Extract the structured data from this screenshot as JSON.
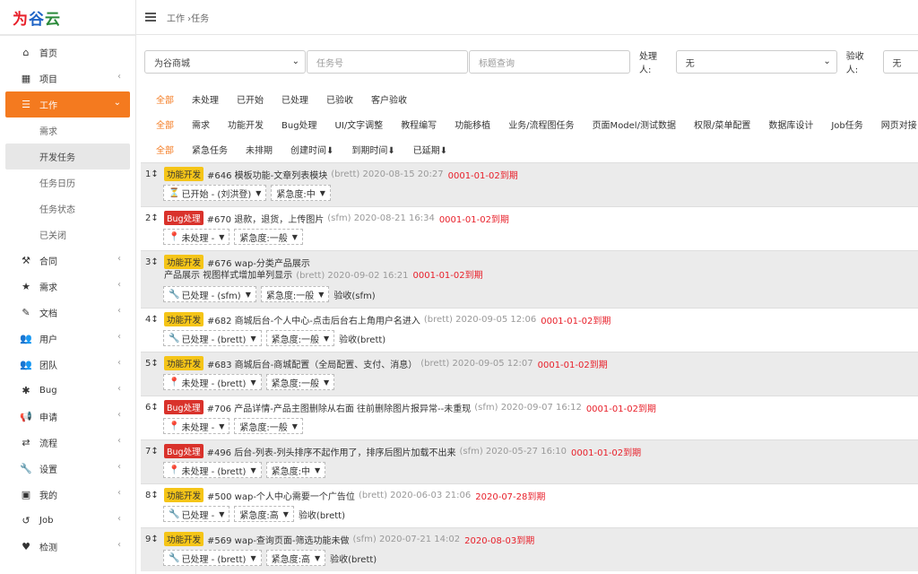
{
  "sidebar": {
    "logo": {
      "c1": "为",
      "c2": "谷",
      "c3": "云"
    },
    "items": [
      {
        "label": "首页",
        "icon": "home-icon",
        "glyph": "⌂"
      },
      {
        "label": "项目",
        "icon": "project-icon",
        "glyph": "▦"
      },
      {
        "label": "工作",
        "icon": "work-icon",
        "glyph": "☰"
      },
      {
        "label": "合同",
        "icon": "contract-icon",
        "glyph": "⚒"
      },
      {
        "label": "需求",
        "icon": "star-icon",
        "glyph": "★"
      },
      {
        "label": "文档",
        "icon": "document-icon",
        "glyph": "✎"
      },
      {
        "label": "用户",
        "icon": "users-icon",
        "glyph": "👥"
      },
      {
        "label": "团队",
        "icon": "team-icon",
        "glyph": "👥"
      },
      {
        "label": "Bug",
        "icon": "bug-icon",
        "glyph": "✱"
      },
      {
        "label": "申请",
        "icon": "megaphone-icon",
        "glyph": "📢"
      },
      {
        "label": "流程",
        "icon": "flow-icon",
        "glyph": "⇄"
      },
      {
        "label": "设置",
        "icon": "wrench-icon",
        "glyph": "🔧"
      },
      {
        "label": "我的",
        "icon": "briefcase-icon",
        "glyph": "▣"
      },
      {
        "label": "Job",
        "icon": "history-icon",
        "glyph": "↺"
      },
      {
        "label": "检测",
        "icon": "heartbeat-icon",
        "glyph": "♥"
      }
    ],
    "work_sub": [
      "需求",
      "开发任务",
      "任务日历",
      "任务状态",
      "已关闭"
    ]
  },
  "topbar": {
    "breadcrumb": "工作 ›任务"
  },
  "filters": {
    "project": "为谷商城",
    "task_no_ph": "任务号",
    "title_ph": "标题查询",
    "handler_label": "处理人:",
    "handler_value": "无",
    "acceptor_label": "验收人:",
    "acceptor_value": "无"
  },
  "tabs": {
    "status": [
      "全部",
      "未处理",
      "已开始",
      "已处理",
      "已验收",
      "客户验收"
    ],
    "type": [
      "全部",
      "需求",
      "功能开发",
      "Bug处理",
      "UI/文字调整",
      "教程编写",
      "功能移植",
      "业务/流程图任务",
      "页面Model/测试数据",
      "权限/菜单配置",
      "数据库设计",
      "Job任务",
      "网页对接"
    ],
    "time": [
      "全部",
      "紧急任务",
      "未排期",
      "创建时间⬇",
      "到期时间⬇",
      "已延期⬇"
    ]
  },
  "tasks": [
    {
      "num": "1↕",
      "badge": "功能开发",
      "title": "#646 模板功能-文章列表模块",
      "meta": "(brett) 2020-08-15 20:27",
      "due": "0001-01-02到期",
      "desc": "",
      "status_icon": "hourglass-icon",
      "status_glyph": "⏳",
      "status": "已开始 - (刘洪登)",
      "urgency": "紧急度:中",
      "accept": ""
    },
    {
      "num": "2↕",
      "badge": "Bug处理",
      "title": "#670 退款，退货，上传图片",
      "meta": "(sfm) 2020-08-21 16:34",
      "due": "0001-01-02到期",
      "desc": "",
      "status_icon": "pin-icon",
      "status_glyph": "📍",
      "status": "未处理 -",
      "urgency": "紧急度:一般",
      "accept": ""
    },
    {
      "num": "3↕",
      "badge": "功能开发",
      "title": "#676 wap-分类产品展示",
      "meta": "",
      "due": "",
      "desc_text": "产品展示 视图样式增加单列显示",
      "desc_meta": "(brett) 2020-09-02 16:21",
      "desc_due": "0001-01-02到期",
      "status_icon": "wrench-icon",
      "status_glyph": "🔧",
      "status": "已处理 - (sfm)",
      "urgency": "紧急度:一般",
      "accept": "验收(sfm)"
    },
    {
      "num": "4↕",
      "badge": "功能开发",
      "title": "#682 商城后台-个人中心-点击后台右上角用户名进入",
      "meta": "(brett) 2020-09-05 12:06",
      "due": "0001-01-02到期",
      "desc": "",
      "status_icon": "wrench-icon",
      "status_glyph": "🔧",
      "status": "已处理 - (brett)",
      "urgency": "紧急度:一般",
      "accept": "验收(brett)"
    },
    {
      "num": "5↕",
      "badge": "功能开发",
      "title": "#683 商城后台-商城配置（全局配置、支付、消息）",
      "meta": "(brett) 2020-09-05 12:07",
      "due": "0001-01-02到期",
      "desc": "",
      "status_icon": "pin-icon",
      "status_glyph": "📍",
      "status": "未处理 - (brett)",
      "urgency": "紧急度:一般",
      "accept": ""
    },
    {
      "num": "6↕",
      "badge": "Bug处理",
      "title": "#706 产品详情-产品主图删除从右面 往前删除图片报异常--未重现",
      "meta": "(sfm) 2020-09-07 16:12",
      "due": "0001-01-02到期",
      "desc": "",
      "status_icon": "pin-icon",
      "status_glyph": "📍",
      "status": "未处理 -",
      "urgency": "紧急度:一般",
      "accept": ""
    },
    {
      "num": "7↕",
      "badge": "Bug处理",
      "title": "#496 后台-列表-列头排序不起作用了，排序后图片加载不出来",
      "meta": "(sfm) 2020-05-27 16:10",
      "due": "0001-01-02到期",
      "desc": "",
      "status_icon": "pin-icon",
      "status_glyph": "📍",
      "status": "未处理 - (brett)",
      "urgency": "紧急度:中",
      "accept": ""
    },
    {
      "num": "8↕",
      "badge": "功能开发",
      "title": "#500 wap-个人中心需要一个广告位",
      "meta": "(brett) 2020-06-03 21:06",
      "due": "2020-07-28到期",
      "desc": "",
      "status_icon": "wrench-icon",
      "status_glyph": "🔧",
      "status": "已处理 -",
      "urgency": "紧急度:高",
      "accept": "验收(brett)"
    },
    {
      "num": "9↕",
      "badge": "功能开发",
      "title": "#569 wap-查询页面-筛选功能未做",
      "meta": "(sfm) 2020-07-21 14:02",
      "due": "2020-08-03到期",
      "desc": "",
      "status_icon": "wrench-icon",
      "status_glyph": "🔧",
      "status": "已处理 - (brett)",
      "urgency": "紧急度:高",
      "accept": "验收(brett)"
    }
  ]
}
